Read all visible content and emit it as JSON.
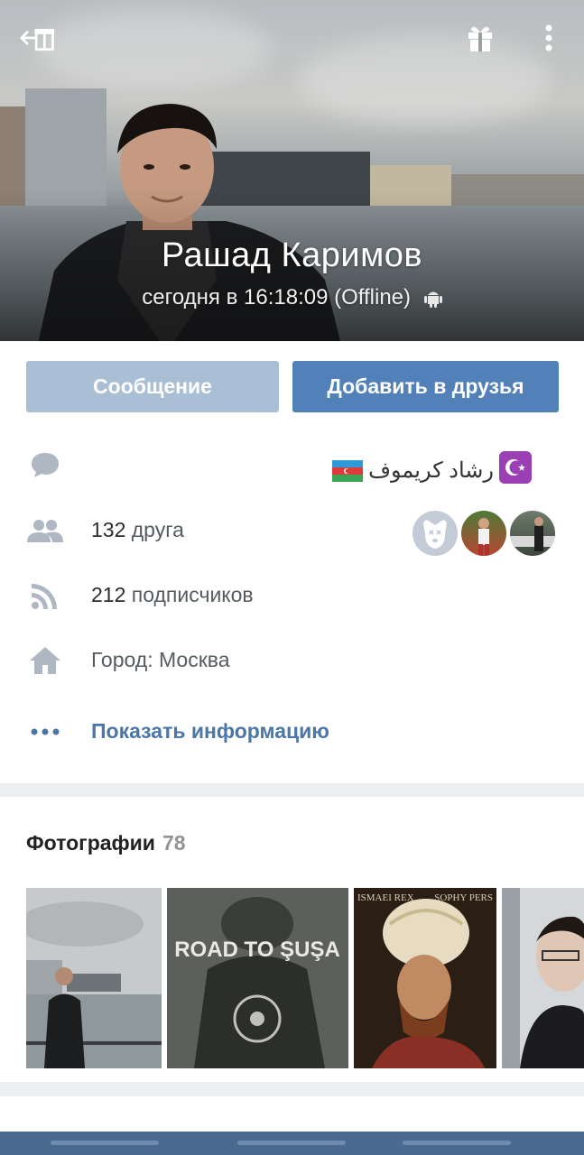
{
  "profile": {
    "name": "Рашад Каримов",
    "last_seen": "сегодня в 16:18:09 (Offline)",
    "native_name": "رشاد كريموف"
  },
  "actions": {
    "message_label": "Сообщение",
    "add_friend_label": "Добавить в друзья"
  },
  "info": {
    "friends_count": "132",
    "friends_label": "друга",
    "followers_count": "212",
    "followers_label": "подписчиков",
    "city": "Город: Москва",
    "show_info": "Показать информацию"
  },
  "photos": {
    "title": "Фотографии",
    "count": "78",
    "items": [
      {
        "caption": ""
      },
      {
        "caption": "ROAD TO ŞUŞA"
      },
      {
        "caption_left": "ISMAEI REX",
        "caption_right": "SOPHY PERS"
      },
      {
        "caption": ""
      }
    ]
  },
  "colors": {
    "accent": "#5181b8",
    "accent_light": "#a9bfd6",
    "link": "#4a76a8",
    "icon": "#aeb7c2"
  },
  "icons": [
    "back-gift-icon",
    "gift-icon",
    "more-icon",
    "android-icon",
    "message-icon",
    "friends-icon",
    "rss-icon",
    "home-icon",
    "dots-icon"
  ]
}
